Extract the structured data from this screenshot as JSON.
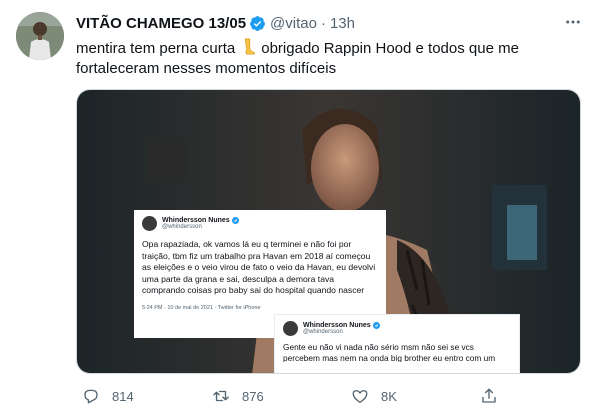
{
  "tweet": {
    "author_name": "VITÃO CHAMEGO 13/05",
    "handle": "@vitao",
    "separator": "·",
    "time": "13h",
    "text_before": "mentira tem perna curta",
    "text_after": "obrigado Rappin Hood e todos que me fortaleceram nesses momentos difíceis",
    "emoji": "leg-emoji"
  },
  "media": {
    "card1": {
      "name": "Whindersson Nunes",
      "handle": "@whindersson",
      "body": "Opa rapaziada, ok vamos lá eu q terminei e não foi por traição, tbm fiz um trabalho pra Havan em 2018 aí começou as eleições e o veio virou de fato o veio da Havan, eu devolvi uma parte da grana e sai, desculpa a demora tava comprando coisas pro baby sai do hospital quando nascer",
      "meta": "5:24 PM · 10 de mai de 2021 · Twitter for iPhone"
    },
    "card2": {
      "name": "Whindersson Nunes",
      "handle": "@whindersson",
      "body": "Gente eu não vi nada não sério msm não sei se vcs percebem mas nem na onda big brother eu entro com um trabalho e isso e nem desculpa pessoal"
    }
  },
  "actions": {
    "replies": "814",
    "retweets": "876",
    "likes": "8K"
  },
  "colors": {
    "text": "#0f1419",
    "secondary": "#536471",
    "verified": "#1d9bf0",
    "border": "#cfd9de"
  },
  "icons": [
    "reply-icon",
    "retweet-icon",
    "like-icon",
    "share-icon",
    "more-icon",
    "verified-badge-icon"
  ]
}
